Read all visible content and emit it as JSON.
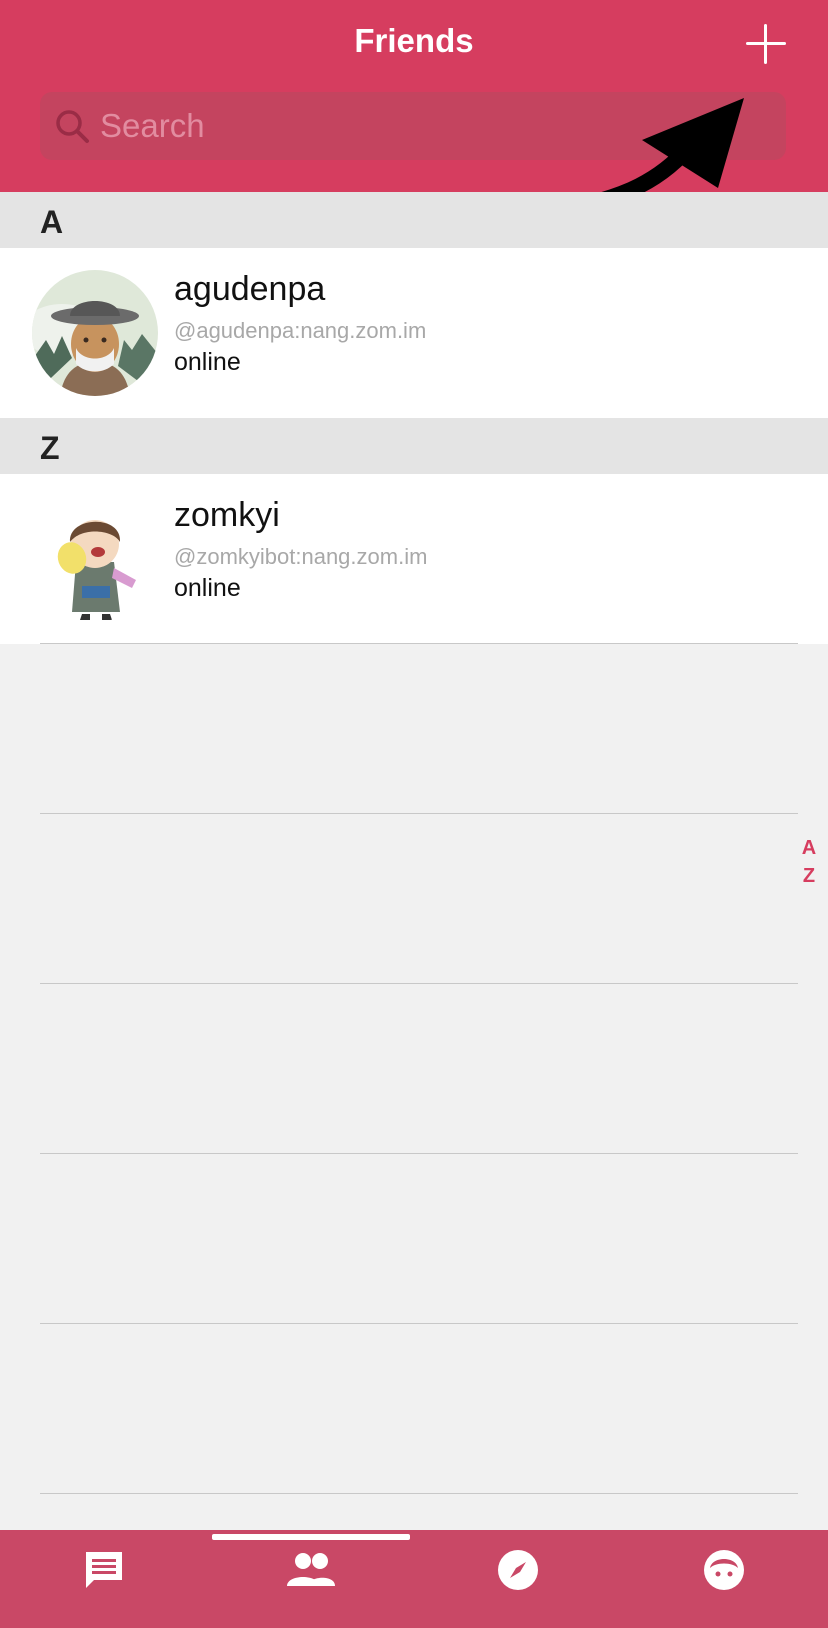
{
  "header": {
    "title": "Friends",
    "add_icon": "plus-icon"
  },
  "search": {
    "placeholder": "Search",
    "icon": "search-icon"
  },
  "sections": [
    {
      "letter": "A",
      "contacts": [
        {
          "name": "agudenpa",
          "id": "@agudenpa:nang.zom.im",
          "status": "online",
          "avatar": "avatar-elder-man-with-hat"
        }
      ]
    },
    {
      "letter": "Z",
      "contacts": [
        {
          "name": "zomkyi",
          "id": "@zomkyibot:nang.zom.im",
          "status": "online",
          "avatar": "avatar-cartoon-girl"
        }
      ]
    }
  ],
  "index": [
    "A",
    "Z"
  ],
  "tabbar": {
    "tabs": [
      {
        "icon": "chat-icon",
        "active": false
      },
      {
        "icon": "friends-icon",
        "active": true
      },
      {
        "icon": "compass-icon",
        "active": false
      },
      {
        "icon": "profile-face-icon",
        "active": false
      }
    ]
  },
  "colors": {
    "accent": "#d63d5f",
    "tabbar": "#c94866",
    "section_bg": "#e4e4e4",
    "page_bg": "#f1f1f1"
  }
}
